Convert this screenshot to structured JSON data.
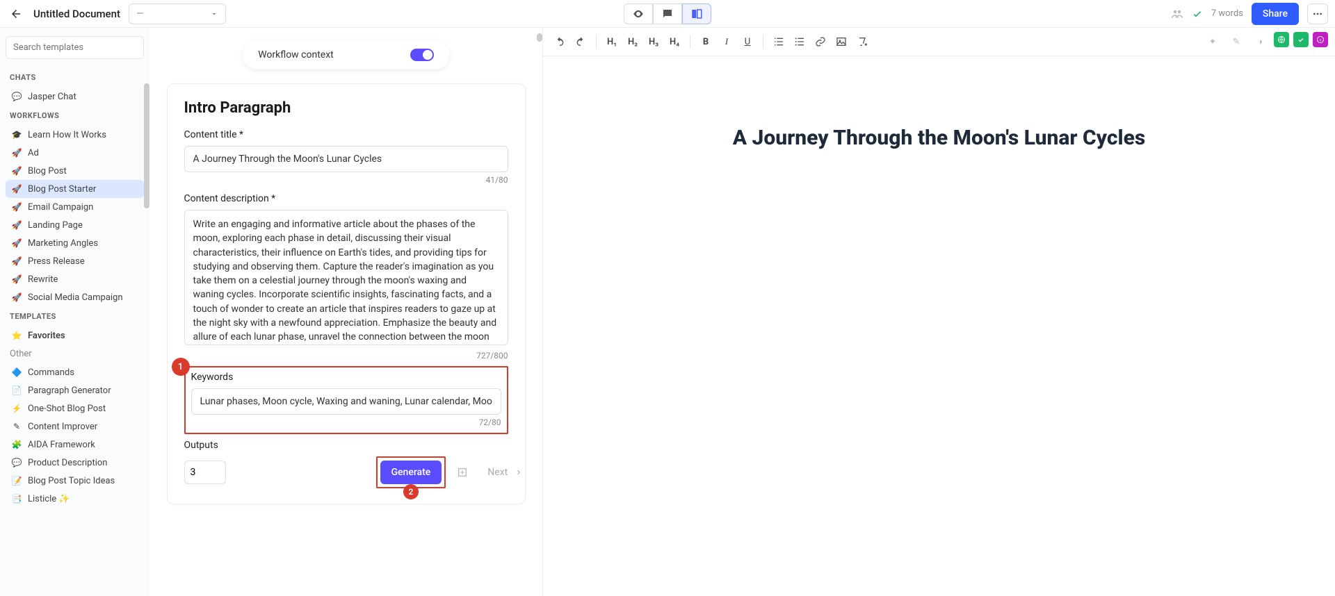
{
  "topbar": {
    "doc_title": "Untitled Document",
    "tone_placeholder": "—",
    "word_count": "7 words",
    "share_label": "Share"
  },
  "sidebar": {
    "search_placeholder": "Search templates",
    "chats_header": "CHATS",
    "chats": [
      {
        "label": "Jasper Chat"
      }
    ],
    "workflows_header": "WORKFLOWS",
    "workflows": [
      {
        "label": "Learn How It Works"
      },
      {
        "label": "Ad"
      },
      {
        "label": "Blog Post"
      },
      {
        "label": "Blog Post Starter",
        "active": true
      },
      {
        "label": "Email Campaign"
      },
      {
        "label": "Landing Page"
      },
      {
        "label": "Marketing Angles"
      },
      {
        "label": "Press Release"
      },
      {
        "label": "Rewrite"
      },
      {
        "label": "Social Media Campaign"
      }
    ],
    "templates_header": "TEMPLATES",
    "favorites_label": "Favorites",
    "other_header": "Other",
    "other_items": [
      {
        "label": "Commands"
      },
      {
        "label": "Paragraph Generator"
      },
      {
        "label": "One-Shot Blog Post"
      },
      {
        "label": "Content Improver"
      },
      {
        "label": "AIDA Framework"
      },
      {
        "label": "Product Description"
      },
      {
        "label": "Blog Post Topic Ideas"
      },
      {
        "label": "Listicle ✨"
      }
    ]
  },
  "form": {
    "workflow_context_label": "Workflow context",
    "title": "Intro Paragraph",
    "content_title_label": "Content title *",
    "content_title_value": "A Journey Through the Moon's Lunar Cycles",
    "content_title_counter": "41/80",
    "content_desc_label": "Content description *",
    "content_desc_value": "Write an engaging and informative article about the phases of the moon, exploring each phase in detail, discussing their visual characteristics, their influence on Earth's tides, and providing tips for studying and observing them. Capture the reader's imagination as you take them on a celestial journey through the moon's waxing and waning cycles. Incorporate scientific insights, fascinating facts, and a touch of wonder to create an article that inspires readers to gaze up at the night sky with a newfound appreciation. Emphasize the beauty and allure of each lunar phase, unravel the connection between the moon and Earth's tides, and empower readers with practical advice on how to embark on their own lunar exploration.",
    "content_desc_counter": "727/800",
    "keywords_label": "Keywords",
    "keywords_value": "Lunar phases, Moon cycle, Waxing and waning, Lunar calendar, Moon phases",
    "keywords_counter": "72/80",
    "outputs_label": "Outputs",
    "outputs_value": "3",
    "generate_label": "Generate",
    "next_label": "Next",
    "badge1": "1",
    "badge2": "2"
  },
  "editor": {
    "headings": {
      "h1": "H₁",
      "h2": "H₂",
      "h3": "H₃",
      "h4": "H₄"
    },
    "doc_heading": "A Journey Through the Moon's Lunar Cycles"
  },
  "colors": {
    "accent": "#5b4dff",
    "primary_blue": "#2f5cff",
    "highlight_red": "#d93a2b",
    "badge_green": "#1fb869",
    "badge_orange": "#ff8a3d",
    "badge_magenta": "#c020c0"
  }
}
